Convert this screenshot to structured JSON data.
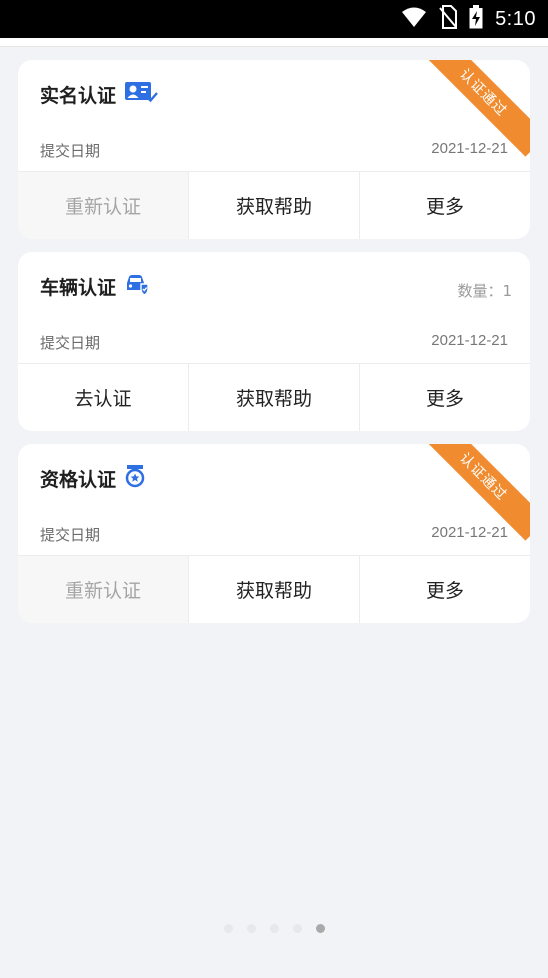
{
  "status_bar": {
    "time": "5:10",
    "icons": [
      "wifi-icon",
      "no-sim-icon",
      "battery-charging-icon"
    ]
  },
  "cards": [
    {
      "title": "实名认证",
      "icon": "id-card-check-icon",
      "ribbon": "认证通过",
      "date_label": "提交日期",
      "date_value": "2021-12-21",
      "actions": [
        "重新认证",
        "获取帮助",
        "更多"
      ]
    },
    {
      "title": "车辆认证",
      "icon": "car-shield-icon",
      "count_label": "数量：1",
      "date_label": "提交日期",
      "date_value": "2021-12-21",
      "actions": [
        "去认证",
        "获取帮助",
        "更多"
      ]
    },
    {
      "title": "资格认证",
      "icon": "medal-icon",
      "ribbon": "认证通过",
      "date_label": "提交日期",
      "date_value": "2021-12-21",
      "actions": [
        "重新认证",
        "获取帮助",
        "更多"
      ]
    }
  ],
  "pager": {
    "total": 5,
    "active_index": 4
  },
  "colors": {
    "accent_blue": "#2f6fe4",
    "ribbon_orange": "#f08c2f",
    "background": "#f2f3f6"
  }
}
